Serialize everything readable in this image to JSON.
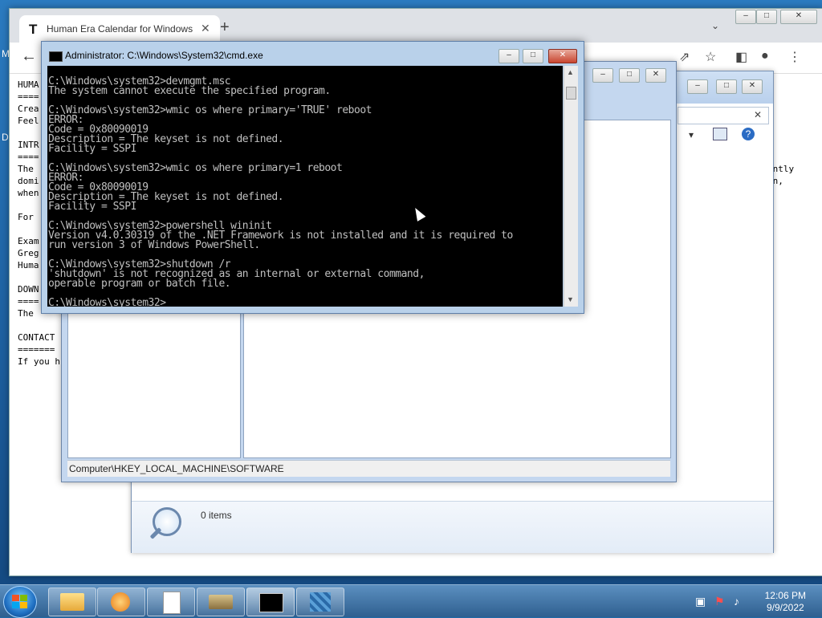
{
  "browser": {
    "tab_title": "Human Era Calendar for Windows",
    "tab_favicon": "T",
    "new_tab": "+",
    "page_lines_left": [
      "HUMA",
      "====",
      "Crea",
      "Feel",
      "",
      "INTR",
      "====",
      "The ",
      "domi",
      "when",
      "",
      "For ",
      "",
      "Exam",
      "Greg",
      "Huma",
      "",
      "DOWN",
      "====",
      "The ",
      "",
      "CONTACT",
      "=======",
      "If you h"
    ],
    "page_lines_right": [
      "ently",
      "on,"
    ]
  },
  "regedit": {
    "status_path": "Computer\\HKEY_LOCAL_MACHINE\\SOFTWARE"
  },
  "explorer": {
    "items_count": "0 items"
  },
  "cmd": {
    "title": "Administrator: C:\\Windows\\System32\\cmd.exe",
    "lines": [
      "C:\\Windows\\system32>devmgmt.msc",
      "The system cannot execute the specified program.",
      "",
      "C:\\Windows\\system32>wmic os where primary='TRUE' reboot",
      "ERROR:",
      "Code = 0x80090019",
      "Description = The keyset is not defined.",
      "Facility = SSPI",
      "",
      "C:\\Windows\\system32>wmic os where primary=1 reboot",
      "ERROR:",
      "Code = 0x80090019",
      "Description = The keyset is not defined.",
      "Facility = SSPI",
      "",
      "C:\\Windows\\system32>powershell wininit",
      "Version v4.0.30319 of the .NET Framework is not installed and it is required to",
      "run version 3 of Windows PowerShell.",
      "",
      "C:\\Windows\\system32>shutdown /r",
      "'shutdown' is not recognized as an internal or external command,",
      "operable program or batch file.",
      "",
      "C:\\Windows\\system32>_"
    ]
  },
  "taskbar": {
    "time": "12:06 PM",
    "date": "9/9/2022"
  }
}
